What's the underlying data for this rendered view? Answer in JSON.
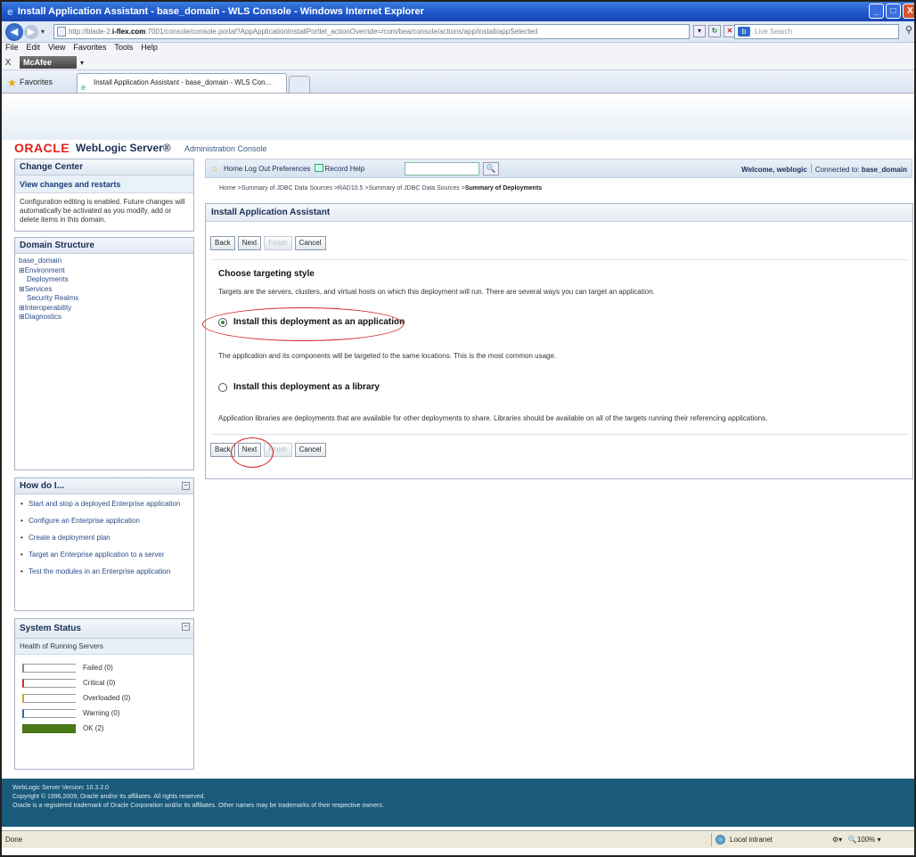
{
  "window": {
    "title": "Install Application Assistant - base_domain - WLS Console - Windows Internet Explorer",
    "buttons": [
      "_",
      "□",
      "X"
    ]
  },
  "address": {
    "url_prefix": "http://blade-2.",
    "url_host": "i-flex.com",
    "url_rest": ":7001/console/console.portal?AppApplicationInstallPortlet_actionOverride=/com/bea/console/actions/app/install/appSelected",
    "search_placeholder": "Live Search",
    "live_logo": "b"
  },
  "menu": [
    "File",
    "Edit",
    "View",
    "Favorites",
    "Tools",
    "Help"
  ],
  "mcafee": {
    "close": "X",
    "label": "McAfee",
    "dropdown": "▾"
  },
  "favorites": {
    "label": "Favorites",
    "tab_title": "Install Application Assistant - base_domain - WLS Con..."
  },
  "oracle": {
    "logo": "ORACLE",
    "product": "WebLogic Server®",
    "subtitle": "Administration Console"
  },
  "change_center": {
    "title": "Change Center",
    "view_link": "View changes and restarts",
    "text": "Configuration editing is enabled. Future changes will automatically be activated as you modify, add or delete items in this domain."
  },
  "domain_structure": {
    "title": "Domain Structure",
    "root": "base_domain",
    "items": [
      "Environment",
      "Deployments",
      "Services",
      "Security Realms",
      "Interoperability",
      "Diagnostics"
    ]
  },
  "how_do_i": {
    "title": "How do I...",
    "items": [
      "Start and stop a deployed Enterprise application",
      "Configure an Enterprise application",
      "Create a deployment plan",
      "Target an Enterprise application to a server",
      "Test the modules in an Enterprise application"
    ]
  },
  "system_status": {
    "title": "System Status",
    "health_title": "Health of Running Servers",
    "rows": [
      {
        "label": "Failed (0)",
        "color": "#888888"
      },
      {
        "label": "Critical (0)",
        "color": "#d03030"
      },
      {
        "label": "Overloaded (0)",
        "color": "#e0a020"
      },
      {
        "label": "Warning (0)",
        "color": "#2a6aa8"
      },
      {
        "label": "OK (2)",
        "color": "#4c7a18"
      }
    ]
  },
  "toolbar": {
    "home": "Home",
    "logout": "Log Out",
    "preferences": "Preferences",
    "record": "Record",
    "help": "Help",
    "search_icon": "🔍",
    "welcome": "Welcome, weblogic",
    "connected_label": "Connected to:",
    "connected_domain": "base_domain"
  },
  "breadcrumb": {
    "path": "Home >Summary of JDBC Data Sources >RAD10.5 >Summary of JDBC Data Sources >",
    "current": "Summary of Deployments"
  },
  "assistant": {
    "title": "Install Application Assistant",
    "back": "Back",
    "next": "Next",
    "finish": "Finish",
    "cancel": "Cancel",
    "section_title": "Choose targeting style",
    "section_desc": "Targets are the servers, clusters, and virtual hosts on which this deployment will run. There are several ways you can target an application.",
    "option_app": "Install this deployment as an application",
    "option_app_desc": "The application and its components will be targeted to the same locations. This is the most common usage.",
    "option_lib": "Install this deployment as a library",
    "option_lib_desc": "Application libraries are deployments that are available for other deployments to share. Libraries should be available on all of the targets running their referencing applications."
  },
  "footer": {
    "line1": "WebLogic Server Version: 10.3.2.0",
    "line2": "Copyright © 1996,2009, Oracle and/or its affiliates. All rights reserved.",
    "line3": "Oracle is a registered trademark of Oracle Corporation and/or its affiliates. Other names may be trademarks of their respective owners."
  },
  "status": {
    "done": "Done",
    "zone": "Local intranet",
    "zoom": "100%"
  }
}
